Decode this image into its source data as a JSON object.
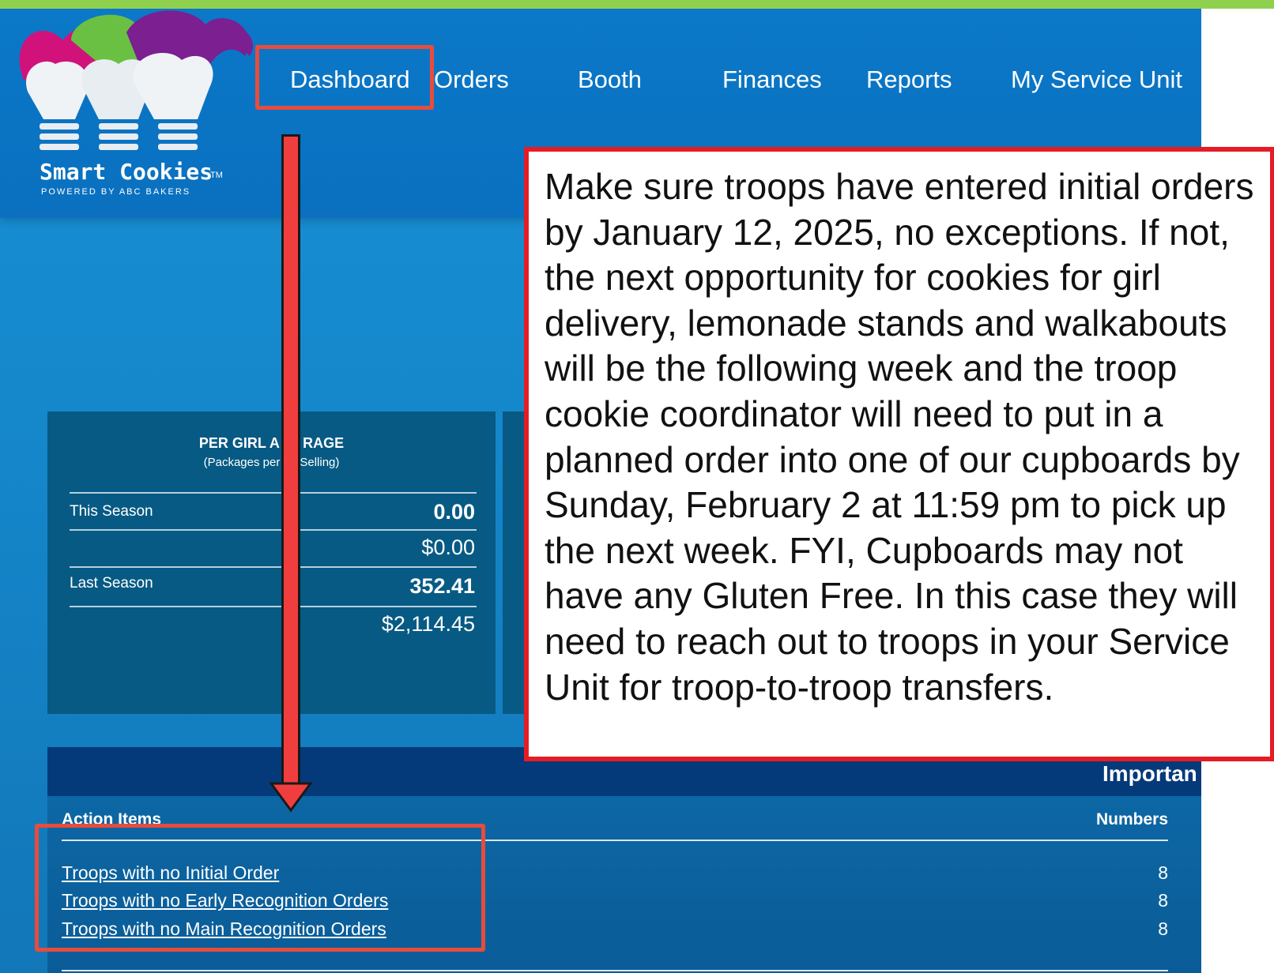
{
  "app": {
    "logo_name": "Smart Cookies",
    "logo_tm": "TM",
    "logo_tagline": "POWERED BY ABC BAKERS",
    "colors": {
      "header_blue": "#0a70bf",
      "top_bar_green": "#8fd14f",
      "highlight_red": "#e74c3c",
      "card_blue": "#075a84",
      "panel_dark_blue": "#053a7a"
    }
  },
  "nav": {
    "items": [
      {
        "label": "Dashboard",
        "highlighted": true
      },
      {
        "label": "Orders"
      },
      {
        "label": "Booth"
      },
      {
        "label": "Finances"
      },
      {
        "label": "Reports"
      },
      {
        "label": "My Service Unit"
      }
    ]
  },
  "per_girl_card": {
    "title": "PER GIRL A      RAGE",
    "subtitle": "(Packages per      Selling)",
    "rows": [
      {
        "label": "This Season",
        "packages": "0.00",
        "dollars": "$0.00"
      },
      {
        "label": "Last Season",
        "packages": "352.41",
        "dollars": "$2,114.45"
      }
    ]
  },
  "important_panel": {
    "title": "Importan",
    "columns": {
      "items": "Action Items",
      "numbers": "Numbers"
    },
    "rows": [
      {
        "label": "Troops with no Initial Order",
        "number": "8"
      },
      {
        "label": "Troops with no Early Recognition Orders",
        "number": "8"
      },
      {
        "label": "Troops with no Main Recognition Orders",
        "number": "8"
      }
    ]
  },
  "callout": {
    "text": "Make sure troops have entered initial orders by January 12, 2025, no exceptions. If not, the next opportunity for cookies for girl delivery, lemonade stands and walkabouts will be the following week and the troop cookie coordinator will need to put in a planned order into one of our cupboards by Sunday, February 2 at 11:59 pm to pick up the next week. FYI, Cupboards may not have any Gluten Free. In this case they will need to reach out to troops in your Service Unit for troop-to-troop transfers."
  }
}
